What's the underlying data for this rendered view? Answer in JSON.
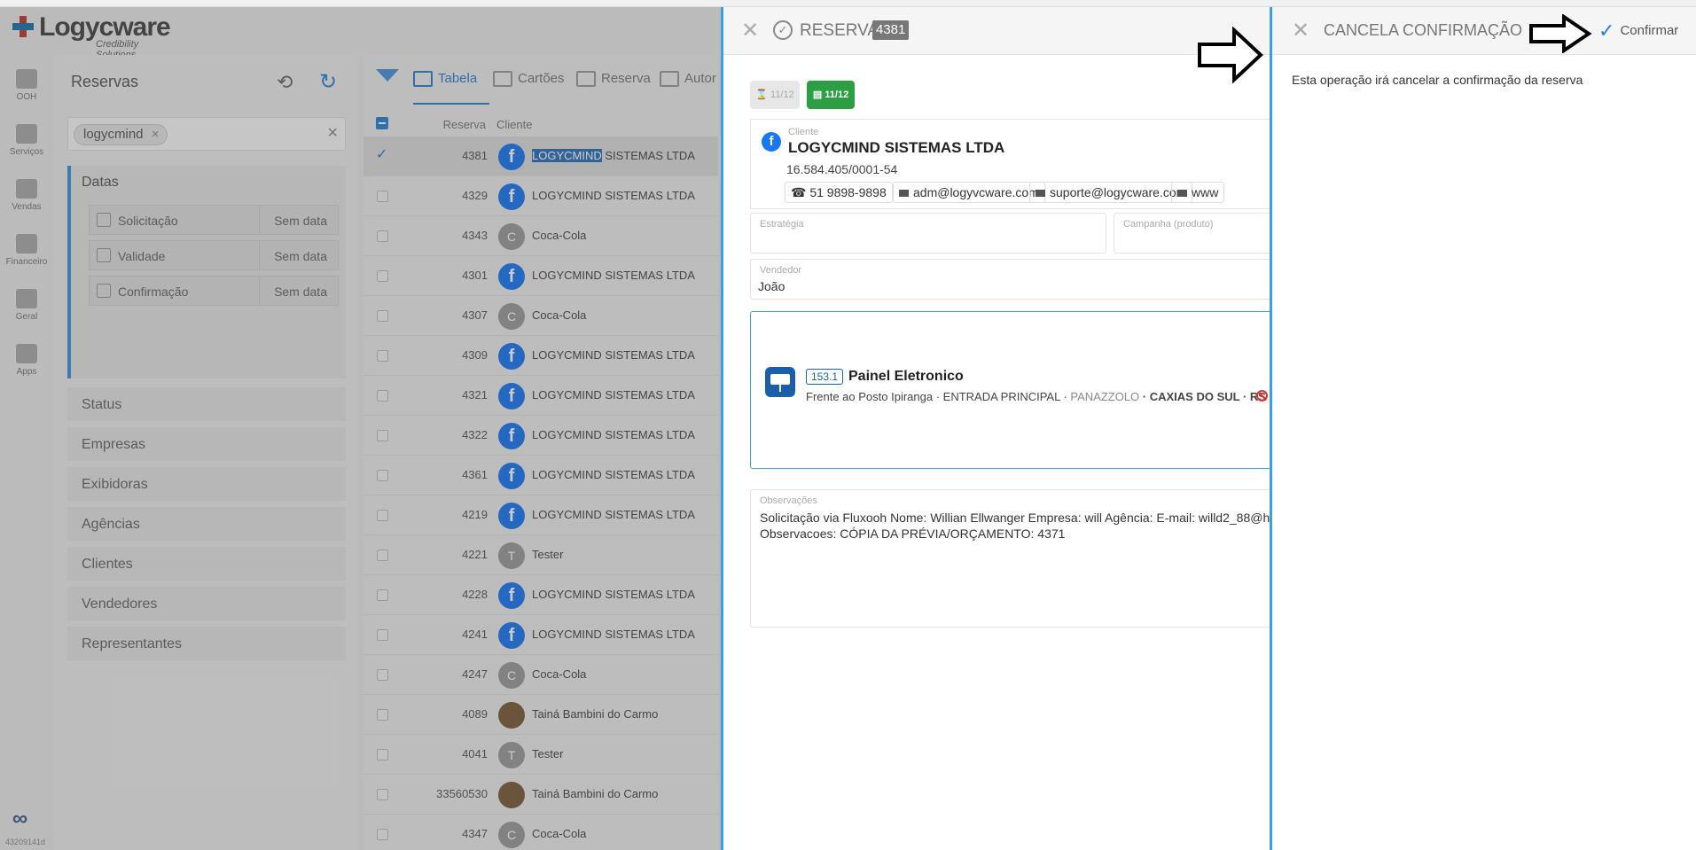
{
  "app": {
    "brand": "Logycware",
    "tagline": "Credibility Solutions",
    "version": "43209141d"
  },
  "nav": [
    {
      "label": "OOH",
      "icon": "flag-icon"
    },
    {
      "label": "Serviços",
      "icon": "tools-icon"
    },
    {
      "label": "Vendas",
      "icon": "briefcase-icon"
    },
    {
      "label": "Financeiro",
      "icon": "dollar-icon"
    },
    {
      "label": "Geral",
      "icon": "folder-icon"
    },
    {
      "label": "Apps",
      "icon": "cloud-icon"
    }
  ],
  "filters": {
    "title": "Reservas",
    "search_chip": "logycmind",
    "datas": {
      "title": "Datas",
      "rows": [
        {
          "label": "Solicitação",
          "value": "Sem data"
        },
        {
          "label": "Validade",
          "value": "Sem data"
        },
        {
          "label": "Confirmação",
          "value": "Sem data"
        }
      ]
    },
    "sections": [
      "Status",
      "Empresas",
      "Exibidoras",
      "Agências",
      "Clientes",
      "Vendedores",
      "Representantes"
    ]
  },
  "toolbar": {
    "tabs": [
      "Tabela",
      "Cartões",
      "Reserva",
      "Autor"
    ]
  },
  "table": {
    "headers": {
      "reserva": "Reserva",
      "cliente": "Cliente"
    },
    "rows": [
      {
        "num": "4381",
        "cliente_hl": "LOGYCMIND",
        "cliente_rest": " SISTEMAS LTDA",
        "avatar": "f",
        "selected": true
      },
      {
        "num": "4329",
        "cliente": "LOGYCMIND SISTEMAS LTDA",
        "avatar": "f"
      },
      {
        "num": "4343",
        "cliente": "Coca-Cola",
        "avatar": "C"
      },
      {
        "num": "4301",
        "cliente": "LOGYCMIND SISTEMAS LTDA",
        "avatar": "f"
      },
      {
        "num": "4307",
        "cliente": "Coca-Cola",
        "avatar": "C"
      },
      {
        "num": "4309",
        "cliente": "LOGYCMIND SISTEMAS LTDA",
        "avatar": "f"
      },
      {
        "num": "4321",
        "cliente": "LOGYCMIND SISTEMAS LTDA",
        "avatar": "f"
      },
      {
        "num": "4322",
        "cliente": "LOGYCMIND SISTEMAS LTDA",
        "avatar": "f"
      },
      {
        "num": "4361",
        "cliente": "LOGYCMIND SISTEMAS LTDA",
        "avatar": "f"
      },
      {
        "num": "4219",
        "cliente": "LOGYCMIND SISTEMAS LTDA",
        "avatar": "f"
      },
      {
        "num": "4221",
        "cliente": "Tester",
        "avatar": "T"
      },
      {
        "num": "4228",
        "cliente": "LOGYCMIND SISTEMAS LTDA",
        "avatar": "f"
      },
      {
        "num": "4241",
        "cliente": "LOGYCMIND SISTEMAS LTDA",
        "avatar": "f"
      },
      {
        "num": "4247",
        "cliente": "Coca-Cola",
        "avatar": "C"
      },
      {
        "num": "4089",
        "cliente": "Tainá Bambini do Carmo",
        "avatar": ""
      },
      {
        "num": "4041",
        "cliente": "Tester",
        "avatar": "T"
      },
      {
        "num": "33560530",
        "cliente": "Tainá Bambini do Carmo",
        "avatar": ""
      },
      {
        "num": "4347",
        "cliente": "Coca-Cola",
        "avatar": "C"
      }
    ]
  },
  "reserva": {
    "title": "RESERVA",
    "number": "4381",
    "badge_pending": "11/12",
    "badge_done": "11/12",
    "cliente_label": "Cliente",
    "cliente_name": "LOGYCMIND SISTEMAS LTDA",
    "cliente_doc": "16.584.405/0001-54",
    "contacts": [
      "51 9898-9898",
      "adm@logyvcware.com",
      "suporte@logycware.com",
      "www"
    ],
    "estrategia_label": "Estratégia",
    "campanha_label": "Campanha (produto)",
    "vendedor_label": "Vendedor",
    "vendedor_value": "João",
    "painel": {
      "code": "153.1",
      "name": "Painel Eletronico",
      "loc_main": "Frente ao Posto Ipiranga · ENTRADA PRINCIPAL · ",
      "loc_bairro": "PANAZZOLO",
      "loc_city": " · CAXIAS DO SUL · RS"
    },
    "obs_label": "Observações",
    "obs_line1": "Solicitação via Fluxooh Nome: Willian Ellwanger Empresa: will Agência: E-mail: willd2_88@h",
    "obs_line2": "Observacoes: CÓPIA DA PRÉVIA/ORÇAMENTO: 4371"
  },
  "cancela": {
    "title": "CANCELA CONFIRMAÇÃO",
    "confirm_label": "Confirmar",
    "message": "Esta operação irá cancelar a confirmação da reserva"
  },
  "colors": {
    "accent": "#2a7fd4",
    "panel_border": "#3b9fe0",
    "facebook": "#1877f2",
    "success": "#2e9e44"
  }
}
